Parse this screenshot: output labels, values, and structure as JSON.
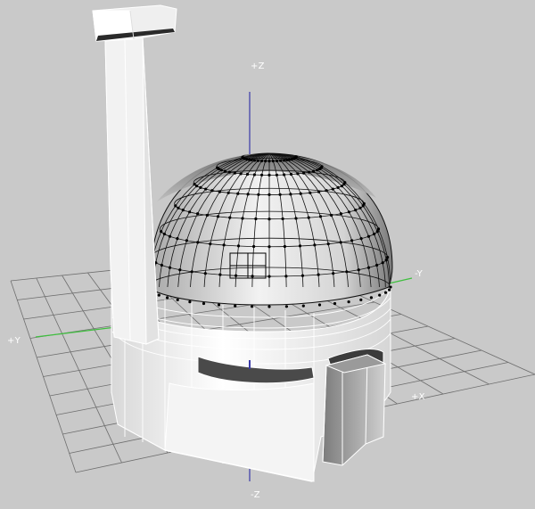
{
  "viewport": {
    "background": "#c9c9c9",
    "axes": {
      "pos_z": "+Z",
      "neg_z": "-Z",
      "pos_y": "+Y",
      "neg_y": "-Y",
      "pos_x": "+X"
    },
    "colors": {
      "grid": "#6e6e6e",
      "z_axis": "#3a3aa8",
      "y_axis": "#3fbf3f",
      "x_axis": "#cc2222",
      "wire": "#111111",
      "vertex": "#000000",
      "selection_edge": "#ffffff"
    },
    "objects": [
      "chimney",
      "dome",
      "cylinder-base",
      "door-wall",
      "side-block",
      "ring-opening"
    ]
  }
}
